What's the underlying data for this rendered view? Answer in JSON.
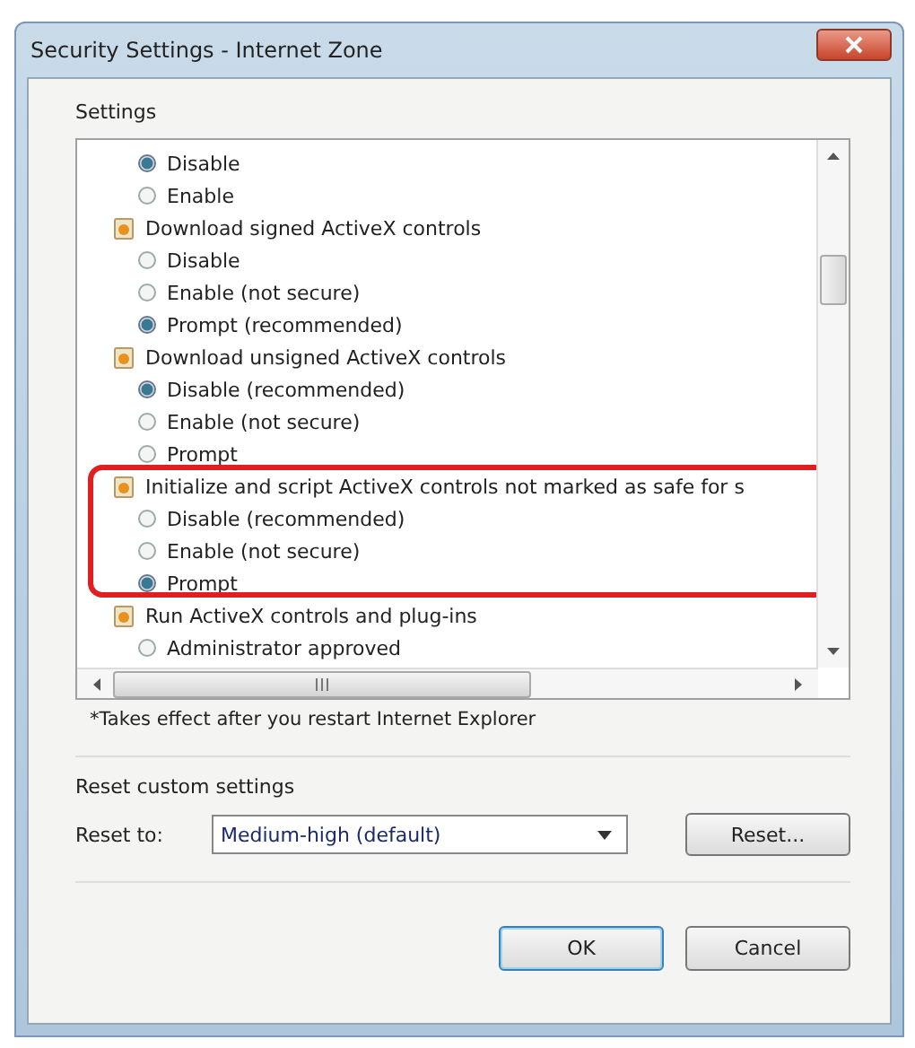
{
  "window": {
    "title": "Security Settings - Internet Zone"
  },
  "settings_label": "Settings",
  "settings_list": {
    "groups": [
      {
        "options": [
          {
            "label": "Disable",
            "selected": true
          },
          {
            "label": "Enable",
            "selected": false
          }
        ],
        "highlighted": false
      },
      {
        "header": "Download signed ActiveX controls",
        "options": [
          {
            "label": "Disable",
            "selected": false
          },
          {
            "label": "Enable (not secure)",
            "selected": false
          },
          {
            "label": "Prompt (recommended)",
            "selected": true
          }
        ],
        "highlighted": false
      },
      {
        "header": "Download unsigned ActiveX controls",
        "options": [
          {
            "label": "Disable (recommended)",
            "selected": true
          },
          {
            "label": "Enable (not secure)",
            "selected": false
          },
          {
            "label": "Prompt",
            "selected": false
          }
        ],
        "highlighted": false
      },
      {
        "header": "Initialize and script ActiveX controls not marked as safe for s",
        "options": [
          {
            "label": "Disable (recommended)",
            "selected": false
          },
          {
            "label": "Enable (not secure)",
            "selected": false
          },
          {
            "label": "Prompt",
            "selected": true
          }
        ],
        "highlighted": true
      },
      {
        "header": "Run ActiveX controls and plug-ins",
        "options": [
          {
            "label": "Administrator approved",
            "selected": false
          }
        ],
        "highlighted": false
      }
    ]
  },
  "footnote": "*Takes effect after you restart Internet Explorer",
  "reset": {
    "section_label": "Reset custom settings",
    "label": "Reset to:",
    "value": "Medium-high (default)",
    "button": "Reset..."
  },
  "buttons": [
    "OK",
    "Cancel"
  ]
}
